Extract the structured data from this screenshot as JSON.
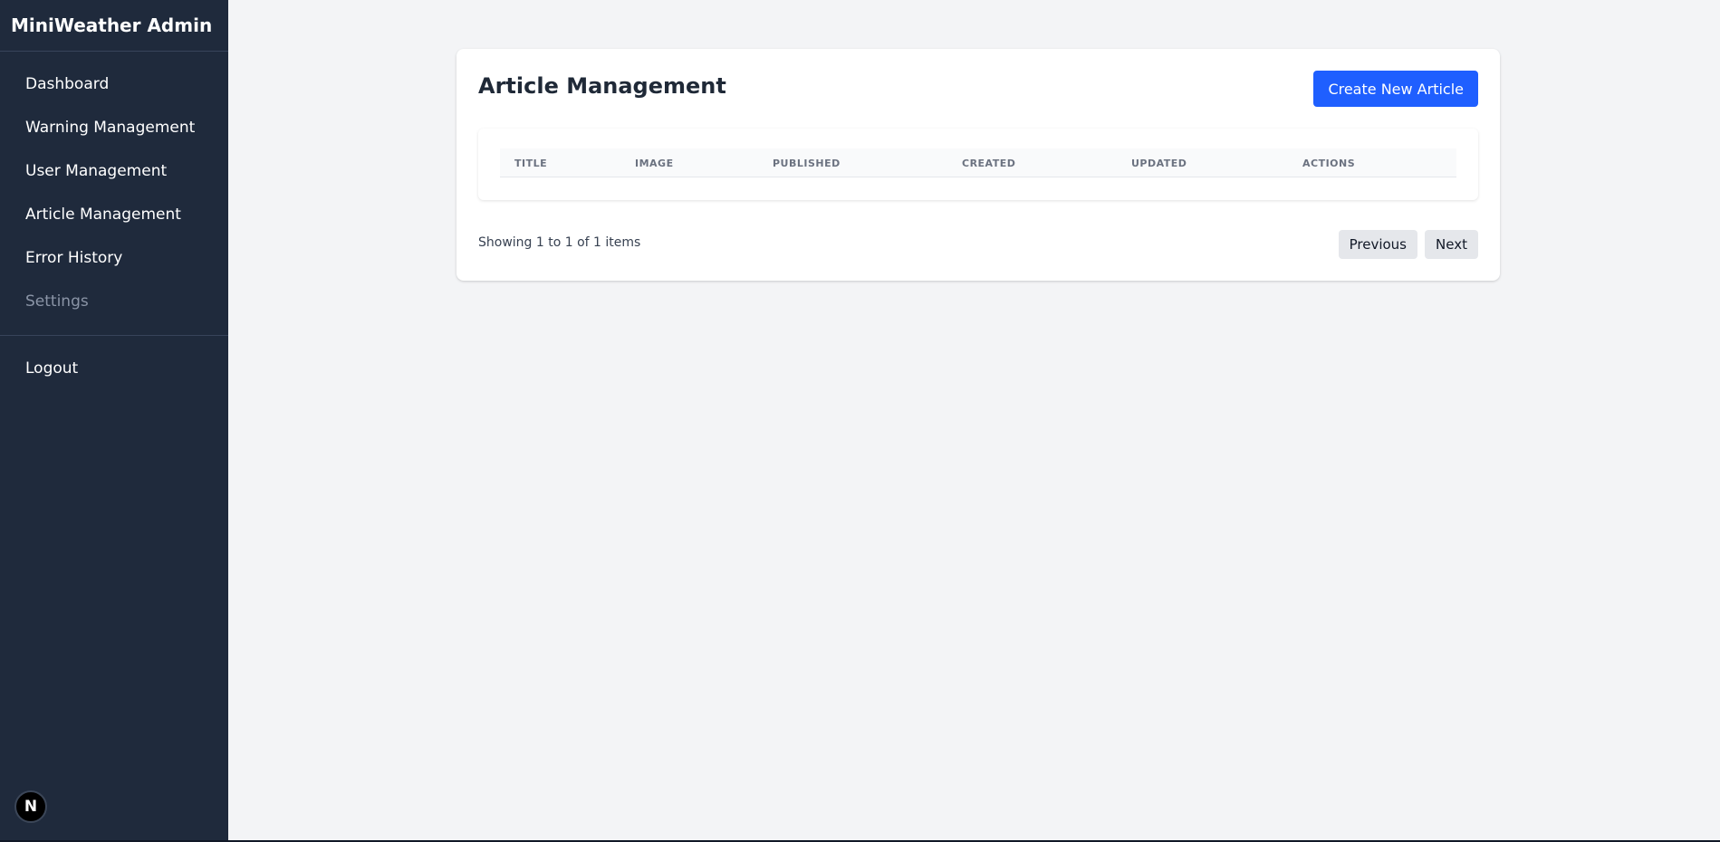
{
  "sidebar": {
    "brand": "MiniWeather Admin",
    "items": [
      {
        "label": "Dashboard"
      },
      {
        "label": "Warning Management"
      },
      {
        "label": "User Management"
      },
      {
        "label": "Article Management"
      },
      {
        "label": "Error History"
      },
      {
        "label": "Settings"
      }
    ],
    "logout_label": "Logout",
    "badge_letter": "N"
  },
  "main": {
    "title": "Article Management",
    "create_button": "Create New Article",
    "table": {
      "columns": [
        "TITLE",
        "IMAGE",
        "PUBLISHED",
        "CREATED",
        "UPDATED",
        "ACTIONS"
      ],
      "rows": []
    },
    "pagination": {
      "showing_text": "Showing 1 to 1 of 1 items",
      "previous_label": "Previous",
      "next_label": "Next"
    }
  },
  "colors": {
    "sidebar_bg": "#1f2a3c",
    "accent": "#1f5fff",
    "page_bg": "#f3f4f6"
  }
}
